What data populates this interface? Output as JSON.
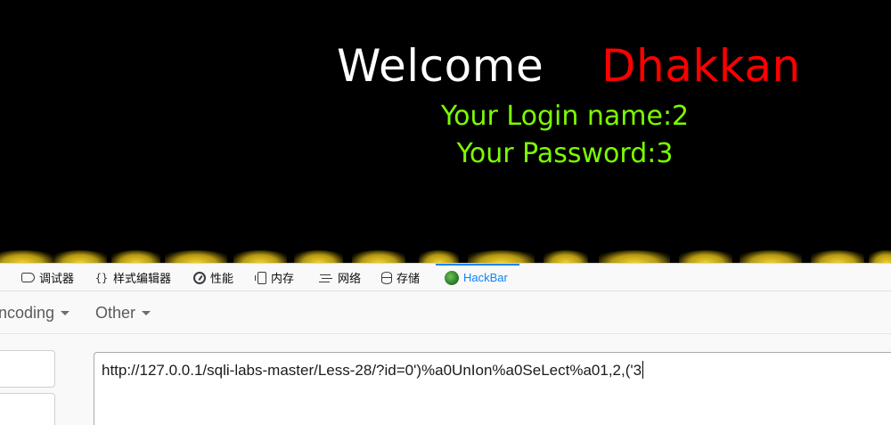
{
  "page": {
    "welcome": "Welcome",
    "name": "Dhakkan",
    "login_line": "Your Login name:2",
    "password_line": "Your Password:3",
    "colors": {
      "background": "#000000",
      "welcome": "#ffffff",
      "name": "#ff0000",
      "info": "#7cfc00",
      "banner": "#f3d22a"
    }
  },
  "devtools": {
    "tabs": [
      {
        "label": "调试器",
        "icon": "debugger-icon"
      },
      {
        "label": "样式编辑器",
        "icon": "style-editor-icon"
      },
      {
        "label": "性能",
        "icon": "performance-icon"
      },
      {
        "label": "内存",
        "icon": "memory-icon"
      },
      {
        "label": "网络",
        "icon": "network-icon"
      },
      {
        "label": "存储",
        "icon": "storage-icon"
      },
      {
        "label": "HackBar",
        "icon": "hackbar-icon",
        "active": true
      }
    ],
    "accent": "#0a84ff"
  },
  "hackbar": {
    "menus": {
      "encoding": "ncoding",
      "other": "Other"
    },
    "url": "http://127.0.0.1/sqli-labs-master/Less-28/?id=0')%a0UnIon%a0SeLect%a01,2,('3"
  }
}
